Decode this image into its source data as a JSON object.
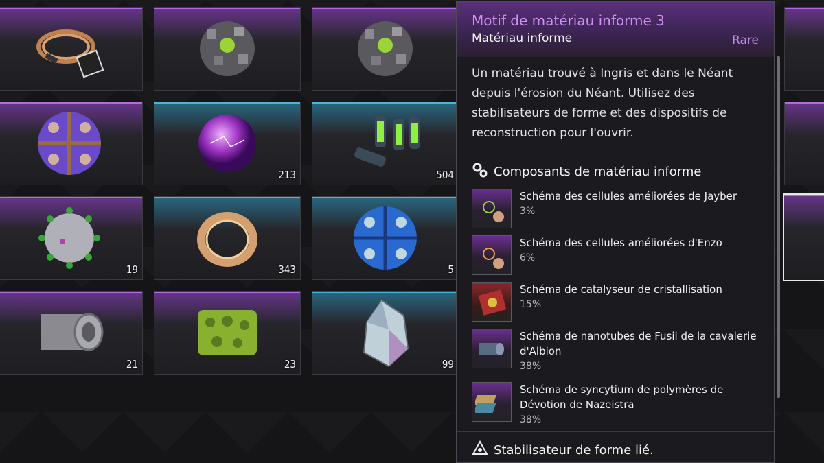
{
  "inventory": {
    "cells": [
      {
        "row": 0,
        "col": 0,
        "rarity": "purple",
        "icon": "cable-coil-icon",
        "qty": ""
      },
      {
        "row": 0,
        "col": 1,
        "rarity": "purple",
        "icon": "amorphous-cube-cluster-icon",
        "qty": ""
      },
      {
        "row": 0,
        "col": 2,
        "rarity": "purple",
        "icon": "amorphous-cube-cluster-icon",
        "qty": ""
      },
      {
        "row": 1,
        "col": 0,
        "rarity": "purple",
        "icon": "purple-orb-device-icon",
        "qty": ""
      },
      {
        "row": 1,
        "col": 1,
        "rarity": "teal",
        "icon": "plasma-sphere-icon",
        "qty": "213"
      },
      {
        "row": 1,
        "col": 2,
        "rarity": "teal",
        "icon": "green-canisters-icon",
        "qty": "504"
      },
      {
        "row": 2,
        "col": 0,
        "rarity": "purple",
        "icon": "virus-sphere-icon",
        "qty": "19"
      },
      {
        "row": 2,
        "col": 1,
        "rarity": "teal",
        "icon": "liquid-ring-icon",
        "qty": "343"
      },
      {
        "row": 2,
        "col": 2,
        "rarity": "teal",
        "icon": "blue-orb-device-icon",
        "qty": "5"
      },
      {
        "row": 3,
        "col": 0,
        "rarity": "purple",
        "icon": "metal-roll-icon",
        "qty": "21"
      },
      {
        "row": 3,
        "col": 1,
        "rarity": "purple",
        "icon": "green-sponge-icon",
        "qty": "23"
      },
      {
        "row": 3,
        "col": 2,
        "rarity": "teal",
        "icon": "crystal-shard-icon",
        "qty": "99"
      }
    ]
  },
  "tooltip": {
    "title": "Motif de matériau informe 3",
    "subtitle": "Matériau informe",
    "rarity": "Rare",
    "description": "Un matériau trouvé à Ingris et dans le Néant depuis l'érosion du Néant. Utilisez des stabilisateurs de forme et des dispositifs de reconstruction pour l'ouvrir.",
    "components_title": "Composants de matériau informe",
    "components": [
      {
        "name": "Schéma des cellules améliorées de Jayber",
        "pct": "3%",
        "icon": "blueprint-cells-icon"
      },
      {
        "name": "Schéma des cellules améliorées d'Enzo",
        "pct": "6%",
        "icon": "blueprint-cells-icon"
      },
      {
        "name": "Schéma de catalyseur de cristallisation",
        "pct": "15%",
        "icon": "catalyst-box-icon"
      },
      {
        "name": "Schéma de nanotubes de Fusil de la cavalerie d'Albion",
        "pct": "38%",
        "icon": "nanotube-roll-icon"
      },
      {
        "name": "Schéma de syncytium de polymères de Dévotion de Nazeistra",
        "pct": "38%",
        "icon": "polymer-sheets-icon"
      }
    ],
    "footer": "Stabilisateur de forme lié."
  },
  "colors": {
    "accent_purple": "#cf8ff2",
    "teal": "#43b8d8"
  }
}
